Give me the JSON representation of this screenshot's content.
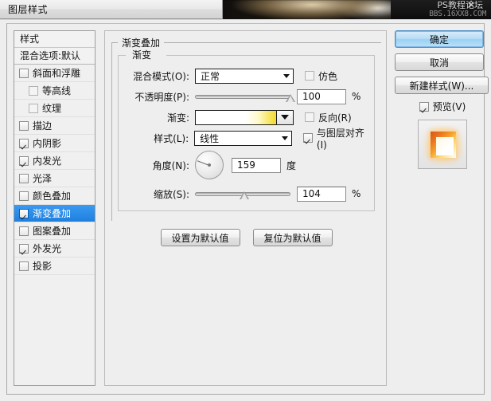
{
  "window": {
    "title": "图层样式"
  },
  "watermark": {
    "line1": "PS教程论坛",
    "line2": "BBS.16XX8.COM",
    "close_glyph": "✕"
  },
  "styles_panel": {
    "header": "样式",
    "blending_options": "混合选项:默认",
    "items": [
      {
        "label": "斜面和浮雕",
        "checked": false,
        "indent": false,
        "selected": false,
        "dim": false
      },
      {
        "label": "等高线",
        "checked": false,
        "indent": true,
        "selected": false,
        "dim": true
      },
      {
        "label": "纹理",
        "checked": false,
        "indent": true,
        "selected": false,
        "dim": true
      },
      {
        "label": "描边",
        "checked": false,
        "indent": false,
        "selected": false,
        "dim": false
      },
      {
        "label": "内阴影",
        "checked": true,
        "indent": false,
        "selected": false,
        "dim": false
      },
      {
        "label": "内发光",
        "checked": true,
        "indent": false,
        "selected": false,
        "dim": false
      },
      {
        "label": "光泽",
        "checked": false,
        "indent": false,
        "selected": false,
        "dim": false
      },
      {
        "label": "颜色叠加",
        "checked": false,
        "indent": false,
        "selected": false,
        "dim": false
      },
      {
        "label": "渐变叠加",
        "checked": true,
        "indent": false,
        "selected": true,
        "dim": false
      },
      {
        "label": "图案叠加",
        "checked": false,
        "indent": false,
        "selected": false,
        "dim": false
      },
      {
        "label": "外发光",
        "checked": true,
        "indent": false,
        "selected": false,
        "dim": false
      },
      {
        "label": "投影",
        "checked": false,
        "indent": false,
        "selected": false,
        "dim": false
      }
    ]
  },
  "main": {
    "group_title": "渐变叠加",
    "subgroup_title": "渐变",
    "rows": {
      "blend_mode": {
        "label": "混合模式(O):",
        "value": "正常"
      },
      "dither": {
        "label": "仿色",
        "checked": false
      },
      "opacity": {
        "label": "不透明度(P):",
        "value": "100",
        "unit": "%",
        "slider_pct": 100
      },
      "gradient": {
        "label": "渐变:",
        "swatch_from": "#ffffff",
        "swatch_to": "#efd93c"
      },
      "reverse": {
        "label": "反向(R)",
        "checked": false
      },
      "style": {
        "label": "样式(L):",
        "value": "线性"
      },
      "align": {
        "label": "与图层对齐(I)",
        "checked": true
      },
      "angle": {
        "label": "角度(N):",
        "value": "159",
        "unit": "度",
        "degrees": 159
      },
      "scale": {
        "label": "缩放(S):",
        "value": "104",
        "unit": "%",
        "slider_pct": 52
      }
    },
    "buttons": {
      "set_default": "设置为默认值",
      "reset_default": "复位为默认值"
    }
  },
  "right_column": {
    "ok": "确定",
    "cancel": "取消",
    "new_style": "新建样式(W)...",
    "preview": {
      "label": "预览(V)",
      "checked": true
    }
  }
}
